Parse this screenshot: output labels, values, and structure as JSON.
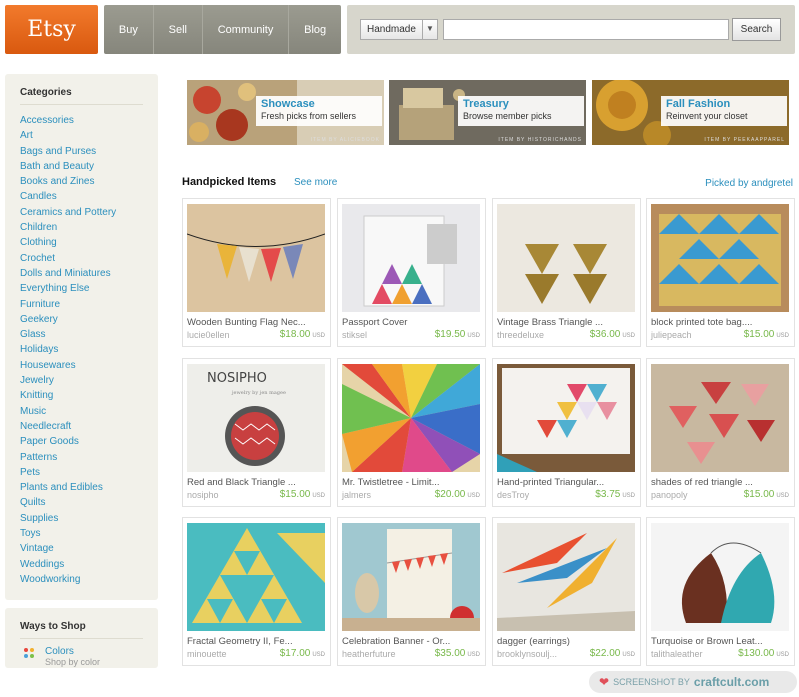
{
  "header": {
    "logo": "Etsy",
    "nav": [
      "Buy",
      "Sell",
      "Community",
      "Blog"
    ],
    "search": {
      "category": "Handmade",
      "placeholder": "",
      "button": "Search"
    }
  },
  "sidebar": {
    "categories_title": "Categories",
    "categories": [
      "Accessories",
      "Art",
      "Bags and Purses",
      "Bath and Beauty",
      "Books and Zines",
      "Candles",
      "Ceramics and Pottery",
      "Children",
      "Clothing",
      "Crochet",
      "Dolls and Miniatures",
      "Everything Else",
      "Furniture",
      "Geekery",
      "Glass",
      "Holidays",
      "Housewares",
      "Jewelry",
      "Knitting",
      "Music",
      "Needlecraft",
      "Paper Goods",
      "Patterns",
      "Pets",
      "Plants and Edibles",
      "Quilts",
      "Supplies",
      "Toys",
      "Vintage",
      "Weddings",
      "Woodworking"
    ],
    "ways_title": "Ways to Shop",
    "ways": [
      {
        "label": "Colors",
        "sub": "Shop by color"
      }
    ]
  },
  "banners": [
    {
      "title": "Showcase",
      "subtitle": "Fresh picks from sellers",
      "credit": "ITEM BY ALICIEBOOK"
    },
    {
      "title": "Treasury",
      "subtitle": "Browse member picks",
      "credit": "ITEM BY HISTORICHANDS"
    },
    {
      "title": "Fall Fashion",
      "subtitle": "Reinvent your closet",
      "credit": "ITEM BY PEEKAAPPAREL"
    }
  ],
  "handpicked": {
    "title": "Handpicked Items",
    "see_more": "See more",
    "picked_by": "Picked by andgretel"
  },
  "items": [
    {
      "title": "Wooden Bunting Flag Nec...",
      "seller": "lucie0ellen",
      "price": "$18.00",
      "currency": "USD"
    },
    {
      "title": "Passport Cover",
      "seller": "stiksel",
      "price": "$19.50",
      "currency": "USD"
    },
    {
      "title": "Vintage Brass Triangle ...",
      "seller": "threedeluxe",
      "price": "$36.00",
      "currency": "USD"
    },
    {
      "title": "block printed tote bag....",
      "seller": "juliepeach",
      "price": "$15.00",
      "currency": "USD"
    },
    {
      "title": "Red and Black Triangle ...",
      "seller": "nosipho",
      "price": "$15.00",
      "currency": "USD"
    },
    {
      "title": "Mr. Twistletree - Limit...",
      "seller": "jalmers",
      "price": "$20.00",
      "currency": "USD"
    },
    {
      "title": "Hand-printed Triangular...",
      "seller": "desTroy",
      "price": "$3.75",
      "currency": "USD"
    },
    {
      "title": "shades of red triangle ...",
      "seller": "panopoly",
      "price": "$15.00",
      "currency": "USD"
    },
    {
      "title": "Fractal Geometry II, Fe...",
      "seller": "minouette",
      "price": "$17.00",
      "currency": "USD"
    },
    {
      "title": "Celebration Banner - Or...",
      "seller": "heatherfuture",
      "price": "$35.00",
      "currency": "USD"
    },
    {
      "title": "dagger (earrings)",
      "seller": "brooklynsoulj...",
      "price": "$22.00",
      "currency": "USD"
    },
    {
      "title": "Turquoise or Brown Leat...",
      "seller": "talithaleather",
      "price": "$130.00",
      "currency": "USD"
    }
  ],
  "item_image_text": {
    "nosipho_brand": "NOSIPHO",
    "nosipho_tagline": "jewelry by jen magee"
  },
  "watermark": {
    "prefix": "SCREENSHOT BY",
    "brand": "craftcult.com"
  }
}
